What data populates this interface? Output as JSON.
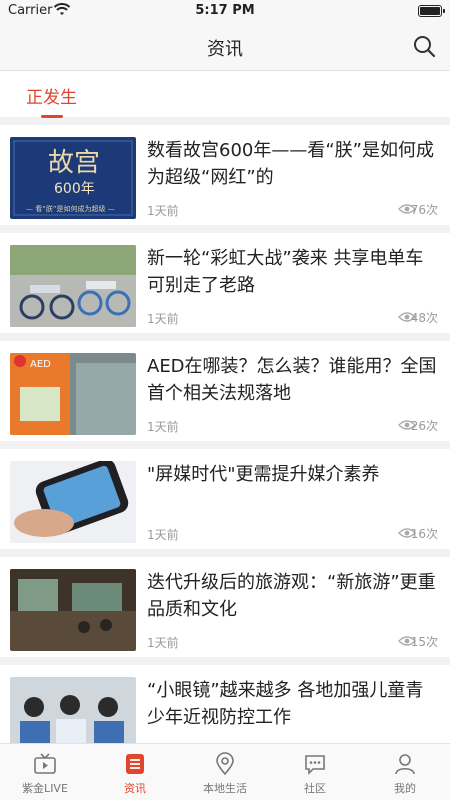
{
  "status": {
    "carrier": "Carrier",
    "time": "5:17 PM"
  },
  "header": {
    "title": "资讯"
  },
  "top_tabs": [
    {
      "label": "正发生"
    }
  ],
  "articles": [
    {
      "title": "数看故宫600年——看“朕”是如何成为超级“网红”的",
      "time": "1天前",
      "views": "76次",
      "thumb_text": {
        "main": "故宫",
        "sub": "600年",
        "caption": "— 看“朕”是如何成为超级 —"
      }
    },
    {
      "title": "新一轮“彩虹大战”袭来 共享电单车可别走了老路",
      "time": "1天前",
      "views": "48次"
    },
    {
      "title": "AED在哪装？怎么装？谁能用？全国首个相关法规落地",
      "time": "1天前",
      "views": "26次",
      "thumb_text": {
        "sign": "AED"
      }
    },
    {
      "title": "\"屏媒时代\"更需提升媒介素养",
      "time": "1天前",
      "views": "16次"
    },
    {
      "title": "迭代升级后的旅游观：“新旅游”更重品质和文化",
      "time": "1天前",
      "views": "15次"
    },
    {
      "title": "“小眼镜”越来越多 各地加强儿童青少年近视防控工作",
      "time": "",
      "views": ""
    }
  ],
  "bottom_tabs": [
    {
      "label": "紫金LIVE",
      "icon": "tv-icon"
    },
    {
      "label": "资讯",
      "icon": "news-list-icon",
      "active": true
    },
    {
      "label": "本地生活",
      "icon": "location-pin-icon"
    },
    {
      "label": "社区",
      "icon": "chat-bubble-icon"
    },
    {
      "label": "我的",
      "icon": "person-icon"
    }
  ],
  "colors": {
    "accent": "#e0462e"
  }
}
